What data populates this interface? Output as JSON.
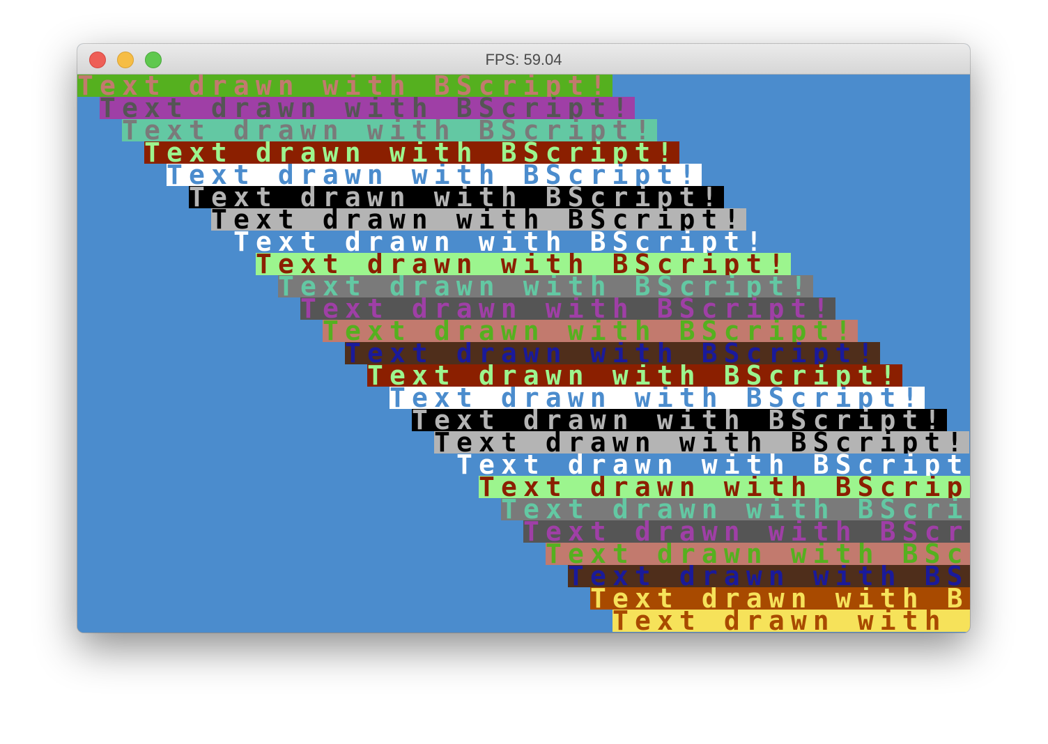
{
  "window": {
    "title": "FPS: 59.04"
  },
  "canvas": {
    "background": "#4b8ccd",
    "strips": [
      {
        "text": "Text drawn with BScript!",
        "fg": "#c27a6e",
        "bg": "#55b01f"
      },
      {
        "text": "Text drawn with BScript!",
        "fg": "#555555",
        "bg": "#9f3fa6"
      },
      {
        "text": "Text drawn with BScript!",
        "fg": "#7a7a7a",
        "bg": "#63c8a3"
      },
      {
        "text": "Text drawn with BScript!",
        "fg": "#9cf58e",
        "bg": "#8b1f00"
      },
      {
        "text": "Text drawn with BScript!",
        "fg": "#4b8ccd",
        "bg": "#ffffff"
      },
      {
        "text": "Text drawn with BScript!",
        "fg": "#b4b4b4",
        "bg": "#000000"
      },
      {
        "text": "Text drawn with BScript!",
        "fg": "#000000",
        "bg": "#b4b4b4"
      },
      {
        "text": "Text drawn with BScript!",
        "fg": "#ffffff",
        "bg": "#4b8ccd"
      },
      {
        "text": "Text drawn with BScript!",
        "fg": "#8b1f00",
        "bg": "#9cf58e"
      },
      {
        "text": "Text drawn with BScript!",
        "fg": "#63c8a3",
        "bg": "#7a7a7a"
      },
      {
        "text": "Text drawn with BScript!",
        "fg": "#9f3fa6",
        "bg": "#555555"
      },
      {
        "text": "Text drawn with BScript!",
        "fg": "#55b01f",
        "bg": "#c27a6e"
      },
      {
        "text": "Text drawn with BScript!",
        "fg": "#1a1a9a",
        "bg": "#4f2e1b"
      },
      {
        "text": "Text drawn with BScript!",
        "fg": "#9cf58e",
        "bg": "#8b1f00"
      },
      {
        "text": "Text drawn with BScript!",
        "fg": "#4b8ccd",
        "bg": "#ffffff"
      },
      {
        "text": "Text drawn with BScript!",
        "fg": "#b4b4b4",
        "bg": "#000000"
      },
      {
        "text": "Text drawn with BScript!",
        "fg": "#000000",
        "bg": "#b4b4b4"
      },
      {
        "text": "Text drawn with BScript!",
        "fg": "#ffffff",
        "bg": "#4b8ccd"
      },
      {
        "text": "Text drawn with BScript!",
        "fg": "#8b1f00",
        "bg": "#9cf58e"
      },
      {
        "text": "Text drawn with BScript!",
        "fg": "#63c8a3",
        "bg": "#7a7a7a"
      },
      {
        "text": "Text drawn with BScript!",
        "fg": "#9f3fa6",
        "bg": "#555555"
      },
      {
        "text": "Text drawn with BScript!",
        "fg": "#55b01f",
        "bg": "#c27a6e"
      },
      {
        "text": "Text drawn with BScript!",
        "fg": "#1a1a9a",
        "bg": "#4f2e1b"
      },
      {
        "text": "Text drawn with BScript!",
        "fg": "#f6e25a",
        "bg": "#a84a00"
      },
      {
        "text": "Text drawn with BScript!",
        "fg": "#a84a00",
        "bg": "#f6e25a"
      }
    ]
  }
}
